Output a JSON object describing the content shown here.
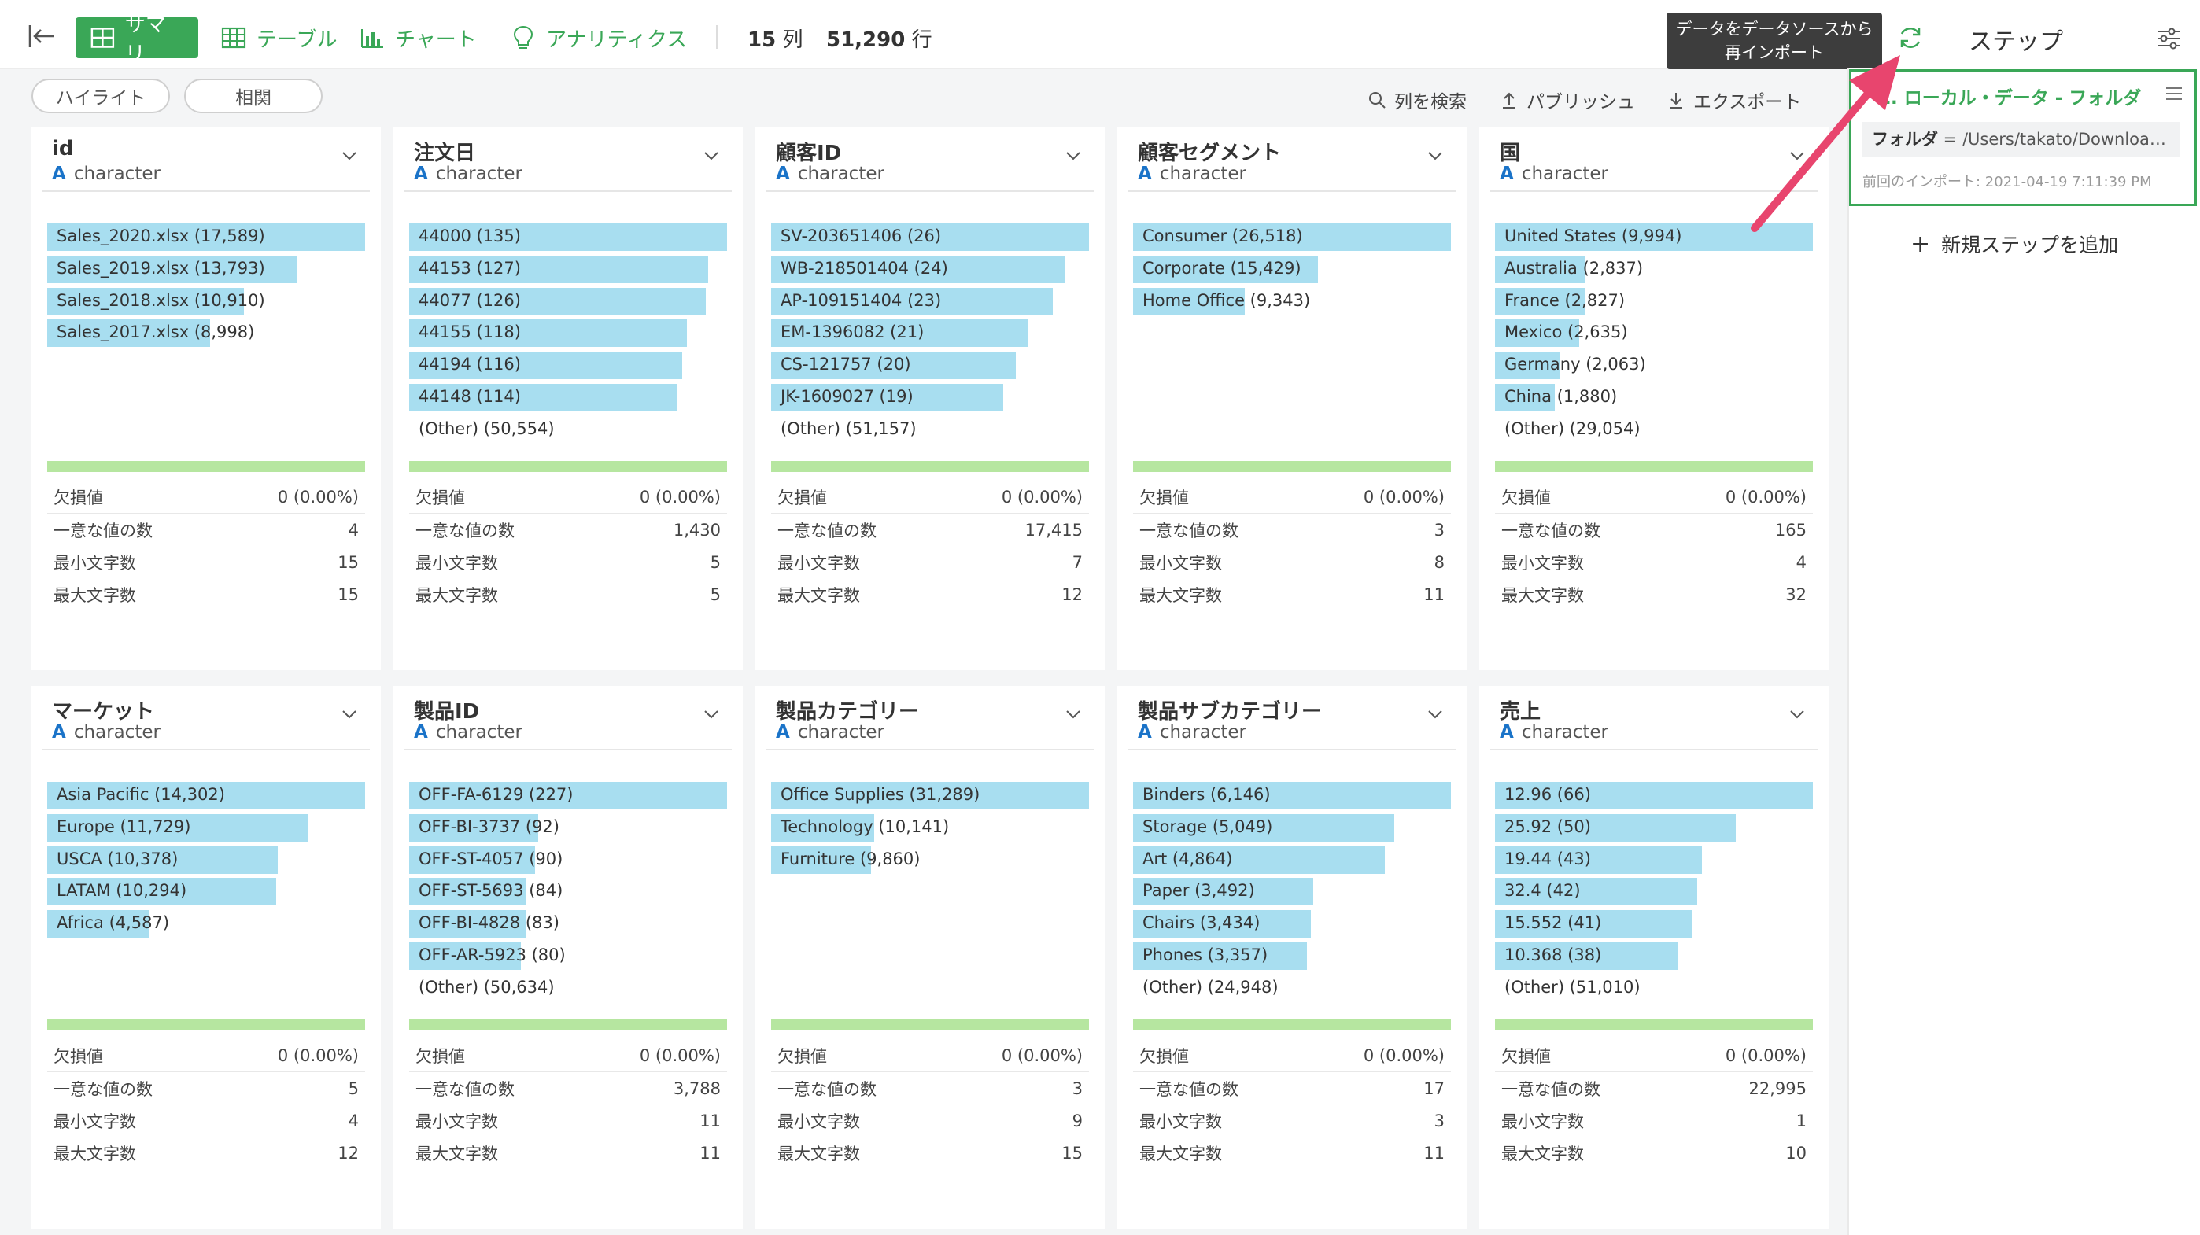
{
  "toolbar": {
    "tabs": [
      {
        "label": "サマリ",
        "icon": "grid-icon",
        "active": true
      },
      {
        "label": "テーブル",
        "icon": "table-icon",
        "active": false
      },
      {
        "label": "チャート",
        "icon": "bar-chart-icon",
        "active": false
      },
      {
        "label": "アナリティクス",
        "icon": "lightbulb-icon",
        "active": false
      }
    ],
    "columns_count": "15",
    "columns_unit": "列",
    "rows_count": "51,290",
    "rows_unit": "行",
    "tooltip": "データをデータソースから再インポート",
    "steps_title": "ステップ"
  },
  "subbar": {
    "highlight_label": "ハイライト",
    "correlation_label": "相関",
    "search_label": "列を検索",
    "publish_label": "パブリッシュ",
    "export_label": "エクスポート"
  },
  "stat_labels": {
    "missing": "欠損値",
    "unique": "一意な値の数",
    "min_len": "最小文字数",
    "max_len": "最大文字数"
  },
  "columns": [
    {
      "name": "id",
      "type": "character",
      "bars": [
        {
          "label": "Sales_2020.xlsx (17,589)",
          "ratio": 1.0
        },
        {
          "label": "Sales_2019.xlsx (13,793)",
          "ratio": 0.784
        },
        {
          "label": "Sales_2018.xlsx (10,910)",
          "ratio": 0.62
        },
        {
          "label": "Sales_2017.xlsx (8,998)",
          "ratio": 0.512
        }
      ],
      "other": "",
      "missing": "0 (0.00%)",
      "unique": "4",
      "min_len": "15",
      "max_len": "15"
    },
    {
      "name": "注文日",
      "type": "character",
      "bars": [
        {
          "label": "44000 (135)",
          "ratio": 1.0
        },
        {
          "label": "44153 (127)",
          "ratio": 0.94
        },
        {
          "label": "44077 (126)",
          "ratio": 0.933
        },
        {
          "label": "44155 (118)",
          "ratio": 0.874
        },
        {
          "label": "44194 (116)",
          "ratio": 0.86
        },
        {
          "label": "44148 (114)",
          "ratio": 0.845
        }
      ],
      "other": "(Other) (50,554)",
      "missing": "0 (0.00%)",
      "unique": "1,430",
      "min_len": "5",
      "max_len": "5"
    },
    {
      "name": "顧客ID",
      "type": "character",
      "bars": [
        {
          "label": "SV-203651406 (26)",
          "ratio": 1.0
        },
        {
          "label": "WB-218501404 (24)",
          "ratio": 0.923
        },
        {
          "label": "AP-109151404 (23)",
          "ratio": 0.885
        },
        {
          "label": "EM-1396082 (21)",
          "ratio": 0.808
        },
        {
          "label": "CS-121757 (20)",
          "ratio": 0.769
        },
        {
          "label": "JK-1609027 (19)",
          "ratio": 0.731
        }
      ],
      "other": "(Other) (51,157)",
      "missing": "0 (0.00%)",
      "unique": "17,415",
      "min_len": "7",
      "max_len": "12"
    },
    {
      "name": "顧客セグメント",
      "type": "character",
      "bars": [
        {
          "label": "Consumer (26,518)",
          "ratio": 1.0
        },
        {
          "label": "Corporate (15,429)",
          "ratio": 0.582
        },
        {
          "label": "Home Office (9,343)",
          "ratio": 0.352
        }
      ],
      "other": "",
      "missing": "0 (0.00%)",
      "unique": "3",
      "min_len": "8",
      "max_len": "11"
    },
    {
      "name": "国",
      "type": "character",
      "bars": [
        {
          "label": "United States (9,994)",
          "ratio": 1.0
        },
        {
          "label": "Australia (2,837)",
          "ratio": 0.284
        },
        {
          "label": "France (2,827)",
          "ratio": 0.283
        },
        {
          "label": "Mexico (2,635)",
          "ratio": 0.264
        },
        {
          "label": "Germany (2,063)",
          "ratio": 0.206
        },
        {
          "label": "China (1,880)",
          "ratio": 0.188
        }
      ],
      "other": "(Other) (29,054)",
      "missing": "0 (0.00%)",
      "unique": "165",
      "min_len": "4",
      "max_len": "32"
    },
    {
      "name": "マーケット",
      "type": "character",
      "bars": [
        {
          "label": "Asia Pacific (14,302)",
          "ratio": 1.0
        },
        {
          "label": "Europe (11,729)",
          "ratio": 0.82
        },
        {
          "label": "USCA (10,378)",
          "ratio": 0.726
        },
        {
          "label": "LATAM (10,294)",
          "ratio": 0.72
        },
        {
          "label": "Africa (4,587)",
          "ratio": 0.321
        }
      ],
      "other": "",
      "missing": "0 (0.00%)",
      "unique": "5",
      "min_len": "4",
      "max_len": "12"
    },
    {
      "name": "製品ID",
      "type": "character",
      "bars": [
        {
          "label": "OFF-FA-6129 (227)",
          "ratio": 1.0
        },
        {
          "label": "OFF-BI-3737 (92)",
          "ratio": 0.405
        },
        {
          "label": "OFF-ST-4057 (90)",
          "ratio": 0.396
        },
        {
          "label": "OFF-ST-5693 (84)",
          "ratio": 0.37
        },
        {
          "label": "OFF-BI-4828 (83)",
          "ratio": 0.366
        },
        {
          "label": "OFF-AR-5923 (80)",
          "ratio": 0.352
        }
      ],
      "other": "(Other) (50,634)",
      "missing": "0 (0.00%)",
      "unique": "3,788",
      "min_len": "11",
      "max_len": "11"
    },
    {
      "name": "製品カテゴリー",
      "type": "character",
      "bars": [
        {
          "label": "Office Supplies (31,289)",
          "ratio": 1.0
        },
        {
          "label": "Technology (10,141)",
          "ratio": 0.324
        },
        {
          "label": "Furniture (9,860)",
          "ratio": 0.315
        }
      ],
      "other": "",
      "missing": "0 (0.00%)",
      "unique": "3",
      "min_len": "9",
      "max_len": "15"
    },
    {
      "name": "製品サブカテゴリー",
      "type": "character",
      "bars": [
        {
          "label": "Binders (6,146)",
          "ratio": 1.0
        },
        {
          "label": "Storage (5,049)",
          "ratio": 0.822
        },
        {
          "label": "Art (4,864)",
          "ratio": 0.791
        },
        {
          "label": "Paper (3,492)",
          "ratio": 0.568
        },
        {
          "label": "Chairs (3,434)",
          "ratio": 0.559
        },
        {
          "label": "Phones (3,357)",
          "ratio": 0.546
        }
      ],
      "other": "(Other) (24,948)",
      "missing": "0 (0.00%)",
      "unique": "17",
      "min_len": "3",
      "max_len": "11"
    },
    {
      "name": "売上",
      "type": "character",
      "bars": [
        {
          "label": "12.96 (66)",
          "ratio": 1.0
        },
        {
          "label": "25.92 (50)",
          "ratio": 0.758
        },
        {
          "label": "19.44 (43)",
          "ratio": 0.652
        },
        {
          "label": "32.4 (42)",
          "ratio": 0.636
        },
        {
          "label": "15.552 (41)",
          "ratio": 0.621
        },
        {
          "label": "10.368 (38)",
          "ratio": 0.576
        }
      ],
      "other": "(Other) (51,010)",
      "missing": "0 (0.00%)",
      "unique": "22,995",
      "min_len": "1",
      "max_len": "10"
    }
  ],
  "steps_panel": {
    "step_title": "1. ローカル・データ - フォルダ",
    "folder_key": "フォルダ",
    "folder_value": " = /Users/takato/Downloa…",
    "last_import": "前回のインポート: 2021-04-19 7:11:39 PM",
    "add_step": "新規ステップを追加"
  },
  "colors": {
    "accent": "#3aa757",
    "bar": "#a8def0",
    "quality": "#b6e6a0",
    "type_letter": "#1a73c8",
    "annotation_arrow": "#e8456e"
  }
}
